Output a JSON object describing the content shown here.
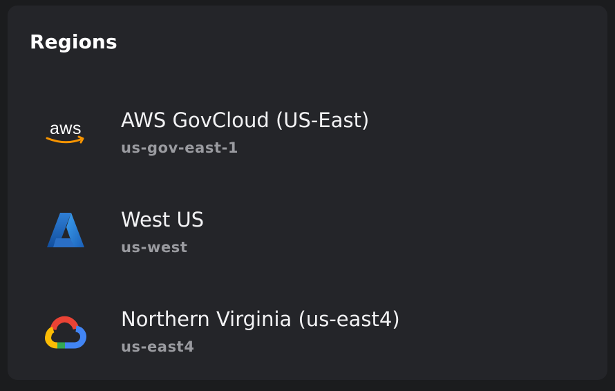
{
  "card": {
    "title": "Regions"
  },
  "regions": [
    {
      "provider_icon": "aws-icon",
      "name": "AWS GovCloud (US-East)",
      "code": "us-gov-east-1"
    },
    {
      "provider_icon": "azure-icon",
      "name": "West US",
      "code": "us-west"
    },
    {
      "provider_icon": "google-cloud-icon",
      "name": "Northern Virginia (us-east4)",
      "code": "us-east4"
    }
  ],
  "colors": {
    "page_background": "#1b1c1e",
    "card_background": "#242529",
    "title_text": "#ffffff",
    "name_text": "#f2f2f4",
    "code_text": "#9a9ba0",
    "aws_orange": "#f79400",
    "azure_blue": "#2e7fd8",
    "gcp_red": "#ea4335",
    "gcp_blue": "#4285f4",
    "gcp_yellow": "#fbbc05",
    "gcp_green": "#34a853"
  }
}
